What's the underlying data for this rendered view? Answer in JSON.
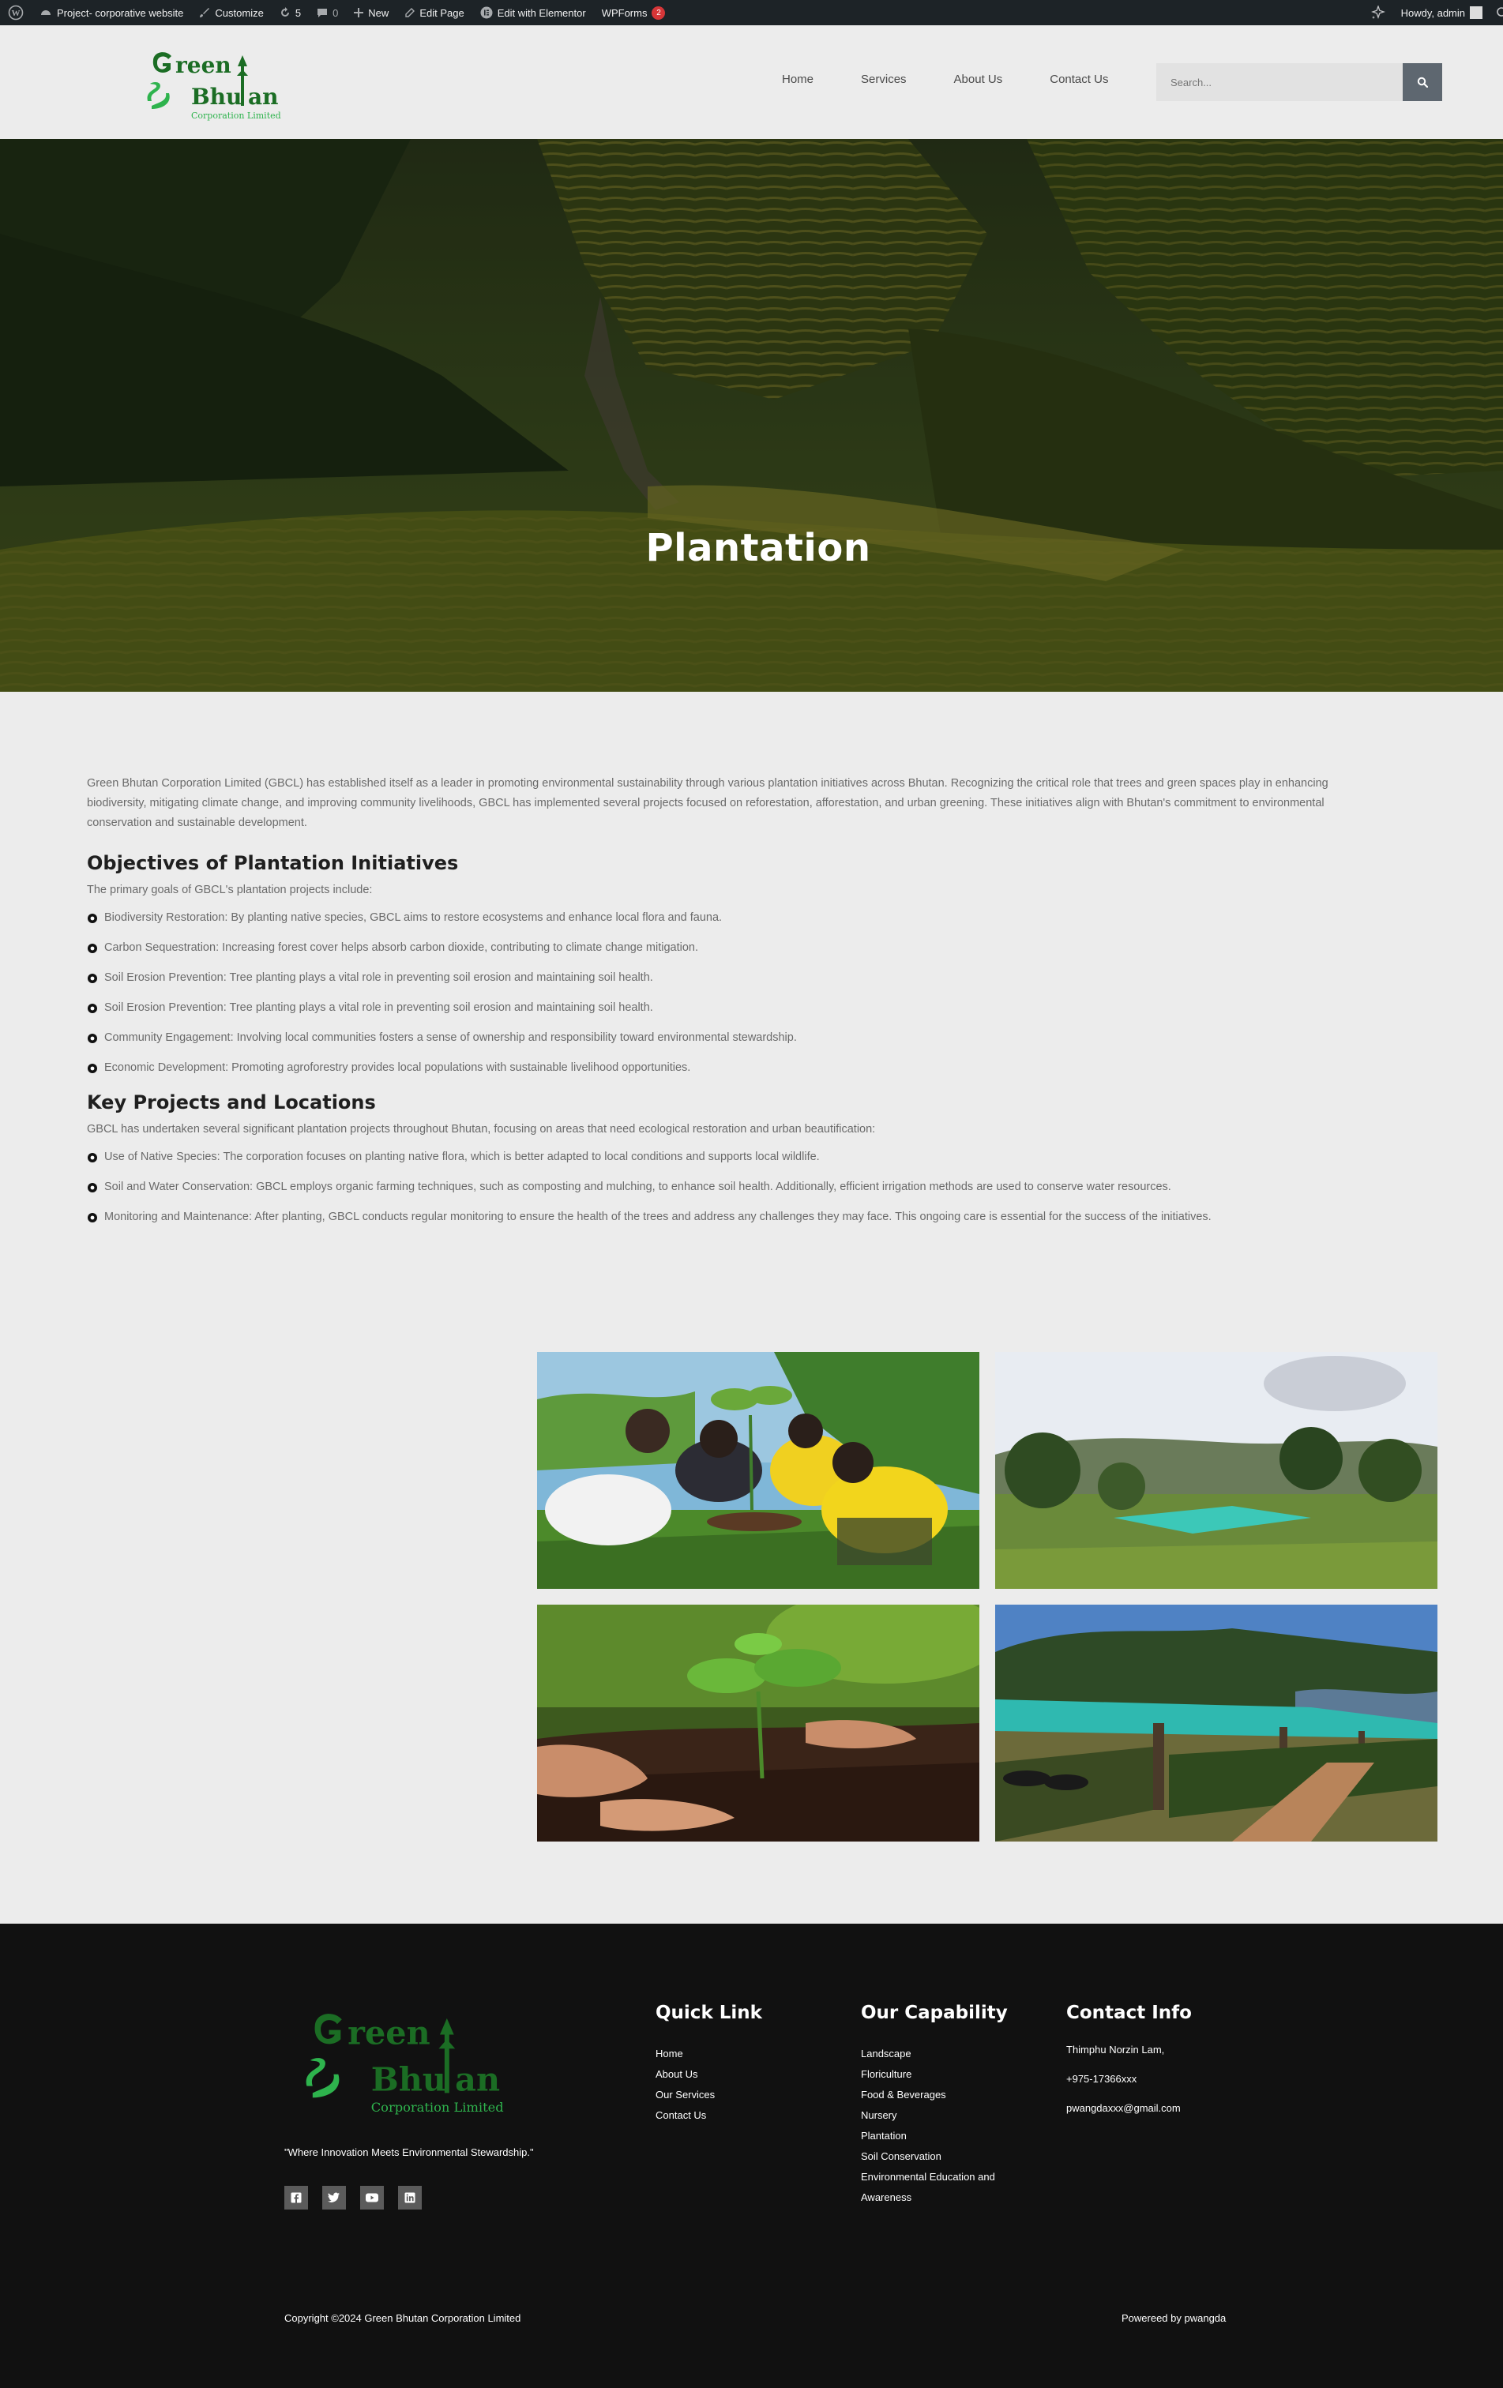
{
  "admin_bar": {
    "site_name": "Project- corporative website",
    "customize": "Customize",
    "updates_count": "5",
    "comments_count": "0",
    "new_label": "New",
    "edit_page": "Edit Page",
    "edit_elementor": "Edit with Elementor",
    "wpforms": "WPForms",
    "wpforms_count": "2",
    "howdy": "Howdy, admin"
  },
  "header": {
    "logo_text": {
      "line1": "reen",
      "line2": "Bhu",
      "line2b": "an",
      "sub": "Corporation Limited"
    },
    "nav": [
      "Home",
      "Services",
      "About Us",
      "Contact Us"
    ],
    "search_placeholder": "Search..."
  },
  "hero": {
    "title": "Plantation"
  },
  "content": {
    "intro": "Green Bhutan Corporation Limited (GBCL) has established itself as a leader in promoting environmental sustainability through various plantation initiatives across Bhutan. Recognizing the critical role that trees and green spaces play in enhancing biodiversity, mitigating climate change, and improving community livelihoods, GBCL has implemented several projects focused on reforestation, afforestation, and urban greening. These initiatives align with Bhutan's commitment to environmental conservation and sustainable development.",
    "objectives_heading": "Objectives of Plantation Initiatives",
    "objectives_lead": "The primary goals of GBCL's plantation projects include:",
    "objectives": [
      "Biodiversity Restoration: By planting native species, GBCL aims to restore ecosystems and enhance local flora and fauna.",
      "Carbon Sequestration: Increasing forest cover helps absorb carbon dioxide, contributing to climate change mitigation.",
      "Soil Erosion Prevention: Tree planting plays a vital role in preventing soil erosion and maintaining soil health.",
      "Soil Erosion Prevention: Tree planting plays a vital role in preventing soil erosion and maintaining soil health.",
      "Community Engagement: Involving local communities fosters a sense of ownership and responsibility toward environmental stewardship.",
      "Economic Development: Promoting agroforestry provides local populations with sustainable livelihood opportunities."
    ],
    "projects_heading": "Key Projects and Locations",
    "projects_lead": "GBCL has undertaken several significant plantation projects throughout Bhutan, focusing on areas that need ecological restoration and urban beautification:",
    "projects": [
      "Use of Native Species: The corporation focuses on planting native flora, which is better adapted to local conditions and supports local wildlife.",
      "Soil and Water Conservation: GBCL employs organic farming techniques, such as composting and mulching, to enhance soil health. Additionally, efficient irrigation methods are used to conserve water resources.",
      "Monitoring and Maintenance: After planting, GBCL conducts regular monitoring to ensure the health of the trees and address any challenges they may face. This ongoing care is essential for the success of the initiatives."
    ]
  },
  "footer": {
    "logo_text": {
      "line1": "reen",
      "line2": "Bhu",
      "line2b": "an",
      "sub": "Corporation Limited"
    },
    "tagline": "\"Where Innovation Meets Environmental Stewardship.\"",
    "quick_link_heading": "Quick Link",
    "quick_links": [
      "Home",
      "About Us",
      "Our Services",
      "Contact Us"
    ],
    "capability_heading": "Our Capability",
    "capabilities": [
      "Landscape",
      "Floriculture",
      "Food & Beverages",
      "Nursery",
      "Plantation",
      "Soil Conservation",
      "Environmental Education and",
      "Awareness"
    ],
    "contact_heading": "Contact Info",
    "contact": [
      "Thimphu Norzin Lam,",
      "+975-17366xxx",
      "pwangdaxxx@gmail.com"
    ],
    "copyright": "Copyright ©2024 Green Bhutan Corporation Limited",
    "powered": "Powereed by pwangda"
  },
  "colors": {
    "brand_green": "#1b7a2a",
    "accent_green": "#22a34a",
    "admin_bar": "#1d2327",
    "footer_bg": "#111111"
  }
}
